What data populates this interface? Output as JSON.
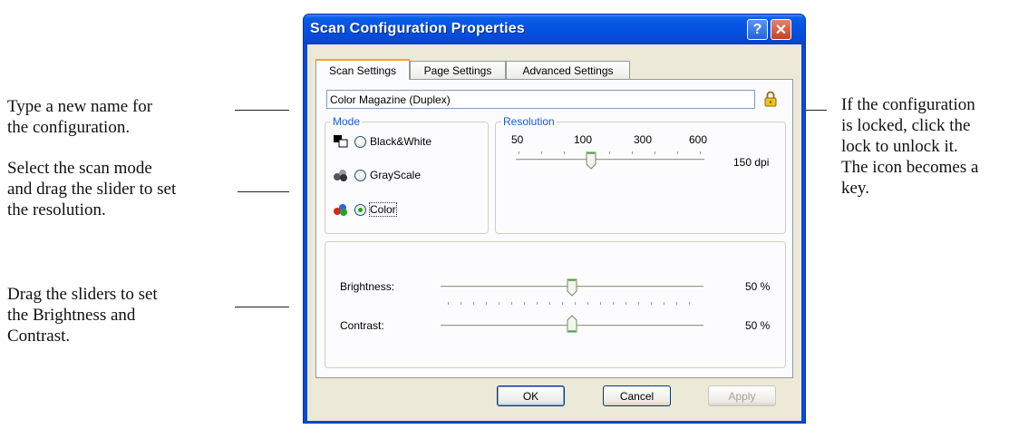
{
  "callouts": {
    "name": [
      "Type a new name for",
      "the configuration."
    ],
    "mode": [
      "Select the scan mode",
      "and drag the slider to set",
      "the resolution."
    ],
    "sliders": [
      "Drag the sliders to set",
      "the Brightness and",
      "Contrast."
    ],
    "lock": [
      "If the configuration",
      "is locked, click the",
      "lock to unlock it.",
      "The icon becomes a",
      "key."
    ]
  },
  "dialog": {
    "title": "Scan Configuration Properties",
    "help_icon": "question-mark-icon",
    "close_icon": "close-x-icon",
    "tabs": [
      "Scan Settings",
      "Page Settings",
      "Advanced Settings"
    ],
    "active_tab": "Scan Settings",
    "config_name": "Color Magazine (Duplex)",
    "lock_icon": "padlock-icon",
    "mode": {
      "label": "Mode",
      "options": [
        {
          "label": "Black&White",
          "icon": "black-white-mode-icon",
          "selected": false
        },
        {
          "label": "GrayScale",
          "icon": "grayscale-mode-icon",
          "selected": false
        },
        {
          "label": "Color",
          "icon": "color-mode-icon",
          "selected": true
        }
      ]
    },
    "resolution": {
      "label": "Resolution",
      "ticks": [
        "50",
        "100",
        "300",
        "600"
      ],
      "value": "150 dpi"
    },
    "brightness": {
      "label": "Brightness:",
      "value": "50 %",
      "level": 0.5
    },
    "contrast": {
      "label": "Contrast:",
      "value": "50 %",
      "level": 0.5
    },
    "buttons": {
      "ok": "OK",
      "cancel": "Cancel",
      "apply": "Apply"
    }
  },
  "colors": {
    "title_bar": "#0A4AD8",
    "dialog_face": "#ECE9D8",
    "group_label": "#1A5BD1"
  }
}
